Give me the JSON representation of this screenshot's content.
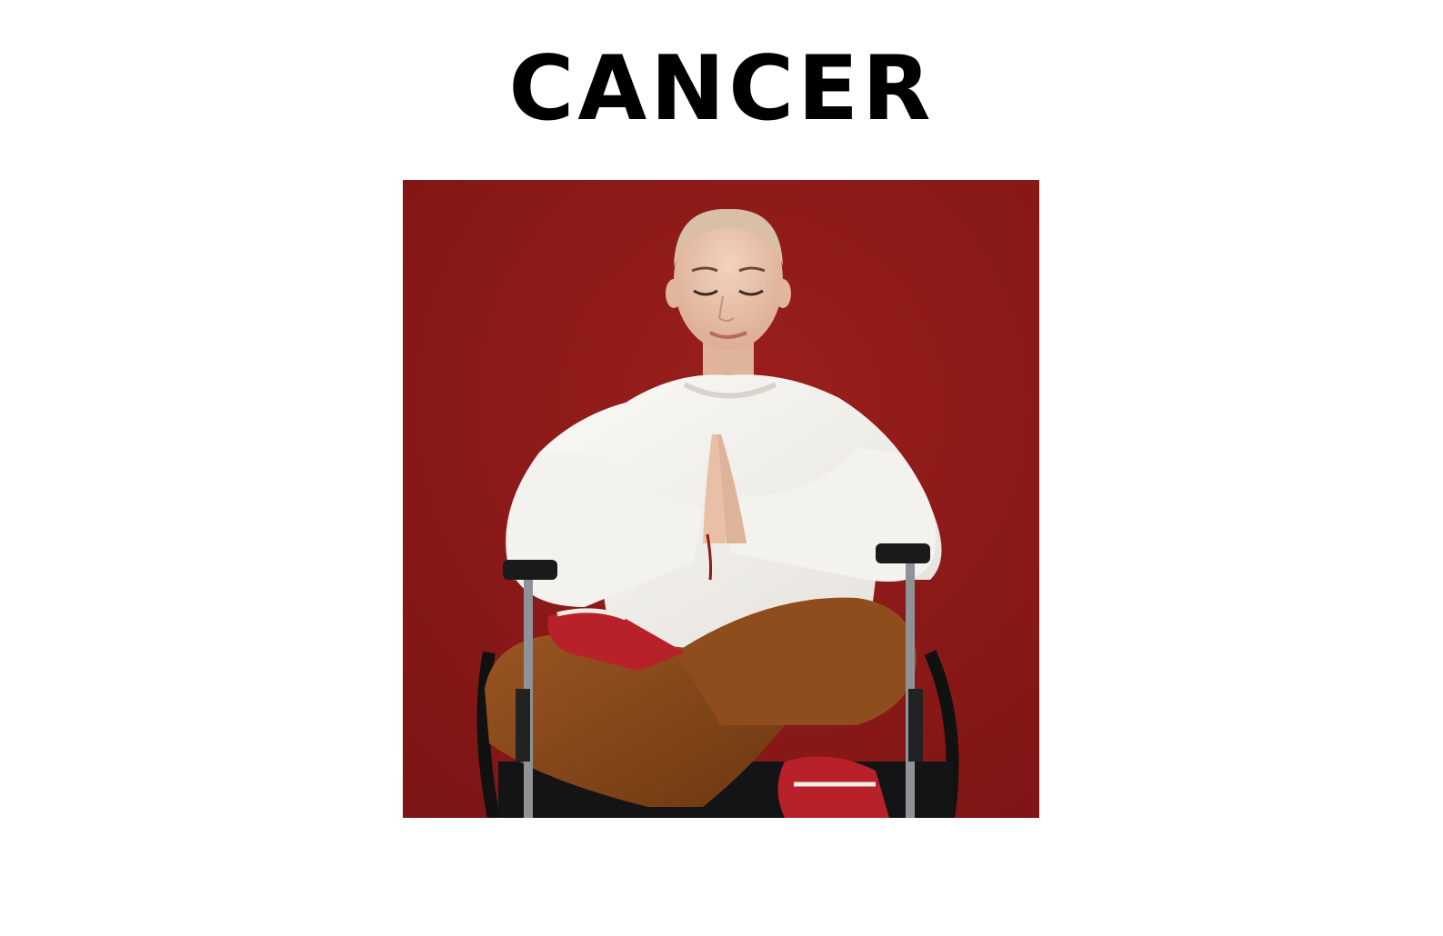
{
  "heading": {
    "text": "CANCER",
    "color": "#000000"
  },
  "photo": {
    "subject": "woman-meditating-in-wheelchair",
    "background_color": "#8c1a1a",
    "sweater_color": "#f2f0ec",
    "trousers_color": "#8a4a1c",
    "sneaker_color": "#b8202a"
  }
}
